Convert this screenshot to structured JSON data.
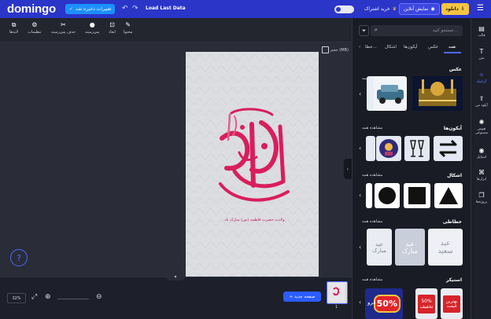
{
  "app": {
    "logo": "domingo",
    "doc_title": "Load Last Data"
  },
  "topbar": {
    "saved_label": "تغییرات ذخیره شد",
    "saved_check": "✓",
    "undo_icon": "↶",
    "redo_icon": "↷",
    "share_label": "خرید اشتراک",
    "preview_label": "نمایش آنلاین",
    "download_label": "دانلود",
    "menu_icon": "☰"
  },
  "toolbar": {
    "tools": [
      {
        "name": "layers",
        "label": "لایه‌ها",
        "glyph": "⧉"
      },
      {
        "name": "settings",
        "label": "تنظیمات",
        "glyph": "⚙"
      },
      {
        "name": "remove-bg",
        "label": "حذف پس‌زمینه",
        "glyph": "✂"
      },
      {
        "name": "background",
        "label": "پس‌زمینه",
        "glyph": "●"
      },
      {
        "name": "dimensions",
        "label": "ابعاد",
        "glyph": "⊡"
      },
      {
        "name": "content",
        "label": "محتوا",
        "glyph": "✎"
      }
    ]
  },
  "canvas": {
    "size_label": "حجم (MB)",
    "help": "?",
    "calligraphy_line": "ولادت حضرت فاطمه (س) مبارک باد",
    "collapse_icon": "›"
  },
  "bottom": {
    "zoom": "32%",
    "new_page": "+ صفحه جدید",
    "page_number": "1",
    "expand_icon": "⤢",
    "zoom_in_icon": "⊕",
    "zoom_out_icon": "⊖",
    "down_icon": "▾"
  },
  "panel": {
    "search_placeholder": "جستجو کنید...",
    "filter_icon": "⏷",
    "search_icon": "⌕",
    "tabs": [
      "همه",
      "عکس",
      "آیکون‌ها",
      "اشکال",
      "خطا..."
    ],
    "sections": [
      {
        "title": "عکس",
        "see_all": "مشاهده همه"
      },
      {
        "title": "آیکون‌ها",
        "see_all": "مشاهده همه"
      },
      {
        "title": "اشکال",
        "see_all": "مشاهده همه"
      },
      {
        "title": "خطاطی",
        "see_all": "مشاهده همه"
      },
      {
        "title": "استیکر",
        "see_all": "مشاهده همه"
      }
    ],
    "calligraphy_texts": [
      "عید سعید",
      "عید مبارک",
      "عید مبارک"
    ],
    "sticker_texts": [
      "50%",
      "50% تخفیف",
      "بهترین قیمت",
      "فرو"
    ]
  },
  "rail": {
    "items": [
      {
        "label": "قالب",
        "glyph": "▤"
      },
      {
        "label": "متن",
        "glyph": "T"
      },
      {
        "label": "گرافیک",
        "glyph": "✧"
      },
      {
        "label": "آپلود من",
        "glyph": "⇪"
      },
      {
        "label": "هوش مصنوعی",
        "glyph": "✺"
      },
      {
        "label": "استایل",
        "glyph": "◉"
      },
      {
        "label": "ابزارها",
        "glyph": "⌘"
      },
      {
        "label": "پروژه‌ها",
        "glyph": "❐"
      }
    ],
    "active": "گرافیک"
  },
  "colors": {
    "brand": "#2b35c8",
    "accent": "#4c6cff",
    "download": "#f5c443",
    "calligraphy": "#d81e5b"
  }
}
